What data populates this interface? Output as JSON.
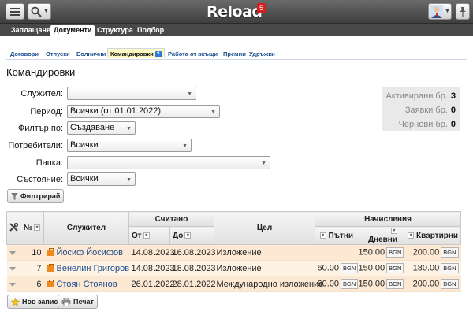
{
  "app": {
    "title": "Reload",
    "notifications": "5"
  },
  "main_tabs": [
    "Заплащане",
    "Документи",
    "Структура",
    "Подбор"
  ],
  "sub_tabs": [
    "Договори",
    "Отпуски",
    "Болнични",
    "Командировки",
    "Работа от вкъщи",
    "Премии",
    "Удръжки"
  ],
  "page_title": "Командировки",
  "filters": {
    "employee": {
      "label": "Служител:",
      "value": ""
    },
    "period": {
      "label": "Период:",
      "value": "Всички (от 01.01.2022)"
    },
    "filter_by": {
      "label": "Филтър по:",
      "value": "Създаване"
    },
    "users": {
      "label": "Потребители:",
      "value": "Всички"
    },
    "folder": {
      "label": "Папка:",
      "value": ""
    },
    "state": {
      "label": "Състояние:",
      "value": "Всички"
    },
    "filter_button": "Филтрирай"
  },
  "stats": {
    "activated_label": "Активирани бр.",
    "activated": "3",
    "requests_label": "Заявки бр.",
    "requests": "0",
    "drafts_label": "Чернови бр.",
    "drafts": "0"
  },
  "table": {
    "headers": {
      "num": "№",
      "employee": "Служител",
      "counted": "Считано",
      "from": "От",
      "to": "До",
      "goal": "Цел",
      "accruals": "Начисления",
      "travel": "Пътни",
      "daily": "Дневни",
      "lodging": "Квартирни"
    },
    "rows": [
      {
        "num": "10",
        "employee": "Йосиф Йосифов",
        "from": "14.08.2023",
        "to": "16.08.2023",
        "goal": "Изложение",
        "travel": "",
        "travel_cur": "",
        "daily": "150.00",
        "daily_cur": "BGN",
        "lodging": "200.00",
        "lodging_cur": "BGN"
      },
      {
        "num": "7",
        "employee": "Венелин Григоров",
        "from": "14.08.2023",
        "to": "18.08.2023",
        "goal": "Изложение",
        "travel": "60.00",
        "travel_cur": "BGN",
        "daily": "150.00",
        "daily_cur": "BGN",
        "lodging": "180.00",
        "lodging_cur": "BGN"
      },
      {
        "num": "6",
        "employee": "Стоян Стоянов",
        "from": "26.01.2022",
        "to": "28.01.2022",
        "goal": "Международно изложение",
        "travel": "60.00",
        "travel_cur": "BGN",
        "daily": "150.00",
        "daily_cur": "BGN",
        "lodging": "200.00",
        "lodging_cur": "BGN"
      }
    ]
  },
  "actions": {
    "new_record": "Нов запис",
    "print": "Печат"
  },
  "colors": {
    "topbar": "#4a4a4a",
    "row_fill": "#fde9d3",
    "link": "#1a4d8f",
    "accent": "#2a7be0"
  }
}
